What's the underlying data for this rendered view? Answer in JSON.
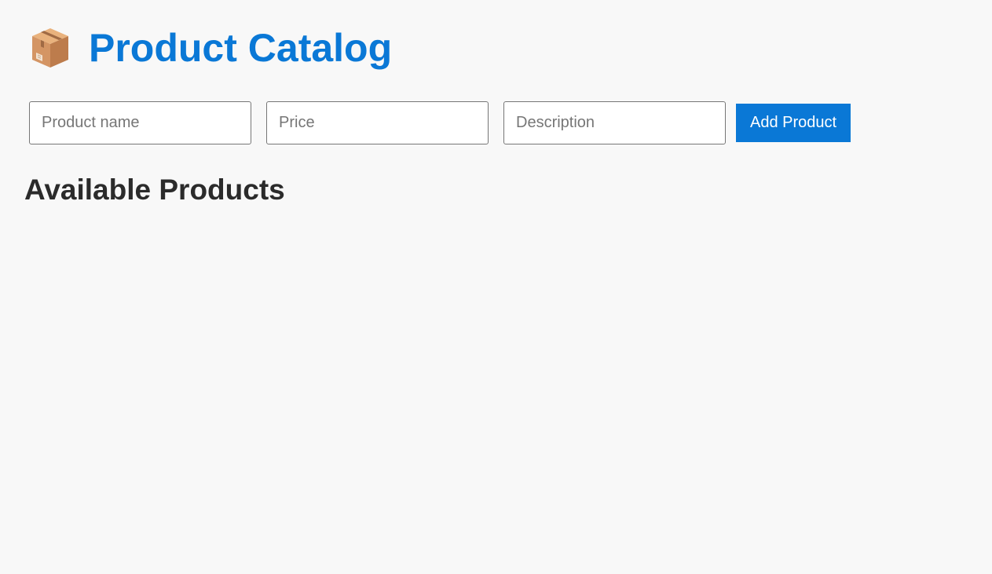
{
  "header": {
    "icon": "package-box-icon",
    "title": "Product Catalog"
  },
  "form": {
    "name_placeholder": "Product name",
    "price_placeholder": "Price",
    "description_placeholder": "Description",
    "name_value": "",
    "price_value": "",
    "description_value": "",
    "add_button_label": "Add Product"
  },
  "products": {
    "heading": "Available Products",
    "items": []
  },
  "colors": {
    "accent": "#0a78d6",
    "background": "#f8f8f8",
    "heading_text": "#2b2b2b"
  }
}
